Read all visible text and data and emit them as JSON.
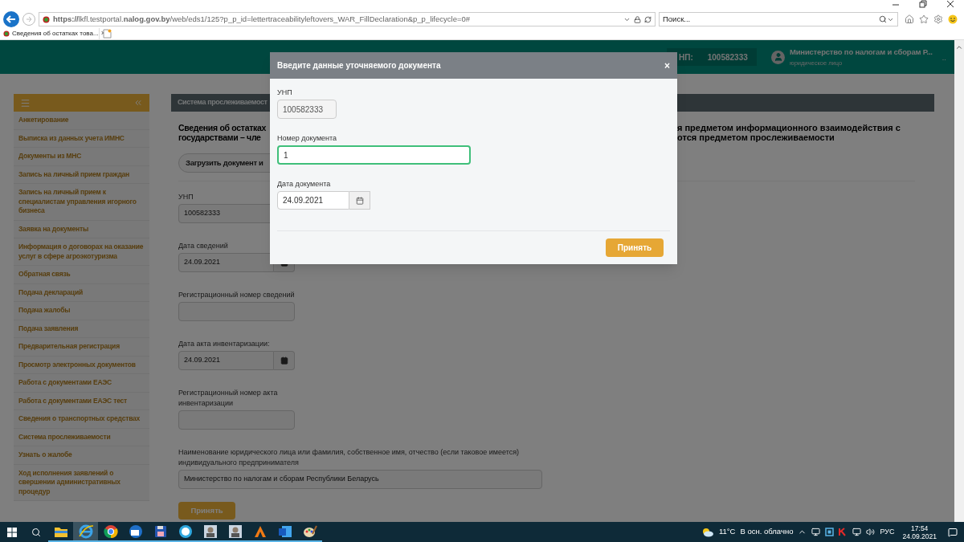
{
  "browser": {
    "url": "**https://**lkfl.testportal.**nalog.gov.by**/web/eds1/125?p_p_id=lettertraceabilityleftovers_WAR_FillDeclaration&p_p_lifecycle=0#",
    "search_placeholder": "Поиск...",
    "tab": {
      "title": "Сведения об остатках това...",
      "close": "×",
      "selected": true
    }
  },
  "header": {
    "unp_label": "НП:",
    "unp_value": "100582333",
    "user_name": "Министерство по налогам и сборам Р...",
    "user_role": "юридическое лицо",
    "more": ".."
  },
  "sidebar": {
    "items": [
      {
        "label": "Анкетирование"
      },
      {
        "label": "Выписка из данных учета ИМНС"
      },
      {
        "label": "Документы из МНС"
      },
      {
        "label": "Запись на личный прием граждан"
      },
      {
        "label": "Запись на личный прием к специалистам управления игорного бизнеса"
      },
      {
        "label": "Заявка на документы"
      },
      {
        "label": "Информация о договорах на оказание услуг в сфере агроэкотуризма"
      },
      {
        "label": "Обратная связь"
      },
      {
        "label": "Подача деклараций"
      },
      {
        "label": "Подача жалобы"
      },
      {
        "label": "Подача заявления"
      },
      {
        "label": "Предварительная регистрация"
      },
      {
        "label": "Просмотр электронных документов"
      },
      {
        "label": "Работа с документами ЕАЭС"
      },
      {
        "label": "Работа с документами ЕАЭС тест"
      },
      {
        "label": "Сведения о транспортных средствах"
      },
      {
        "label": "Система прослеживаемости"
      },
      {
        "label": "Узнать о жалобе"
      },
      {
        "label": "Ход исполнения заявлений о свершении административных процедур"
      }
    ]
  },
  "panel": {
    "title": "Система прослеживаемост",
    "heading_left": [
      "Сведения об остатках",
      "государствами – чле"
    ],
    "heading_right": [
      "я предметом информационного взаимодействия с",
      "отся предметом прослеживаемости"
    ],
    "load_button": "Загрузить документ и",
    "fields": [
      {
        "kind": "text",
        "label": "УНП",
        "value": "100582333"
      },
      {
        "kind": "date",
        "label": "Дата сведений",
        "value": "24.09.2021"
      },
      {
        "kind": "text",
        "label": "Регистрационный номер сведений"
      },
      {
        "kind": "date",
        "label": "Дата акта инвентаризации:",
        "value": "24.09.2021"
      },
      {
        "kind": "narrow-label",
        "label": "Регистрационный номер акта инвентаризации"
      },
      {
        "kind": "wide",
        "label": "Наименование юридического лица или фамилия, собственное имя, отчество (если таковое имеется) индивидуального предпринимателя",
        "value": "Министерство по налогам и сборам Республики Беларусь"
      }
    ],
    "submit": "Принять"
  },
  "modal": {
    "title": "Введите данные уточняемого документа",
    "close": "×",
    "fields": [
      {
        "kind": "short",
        "label": "УНП",
        "value": "100582333",
        "focused": false
      },
      {
        "kind": "text",
        "label": "Номер документа",
        "value": "1",
        "focused": true
      },
      {
        "kind": "date",
        "label": "Дата документа",
        "value": "24.09.2021",
        "focused": false
      }
    ],
    "submit": "Принять"
  },
  "taskbar": {
    "apps": [
      {
        "kind": "folder",
        "selected": false
      },
      {
        "kind": "ie",
        "selected": true
      },
      {
        "kind": "chrome",
        "selected": false
      },
      {
        "kind": "mail",
        "selected": false
      },
      {
        "kind": "floppy",
        "selected": false
      },
      {
        "kind": "clock24",
        "selected": false
      },
      {
        "kind": "portrait",
        "selected": false
      },
      {
        "kind": "portrait",
        "selected": false
      },
      {
        "kind": "orange",
        "selected": false
      },
      {
        "kind": "word",
        "selected": false
      },
      {
        "kind": "paint",
        "selected": false
      }
    ],
    "temperature": "11°C",
    "weather": "В осн. облачно",
    "language": "РУС",
    "time": "17:54",
    "date": "24.09.2021"
  }
}
